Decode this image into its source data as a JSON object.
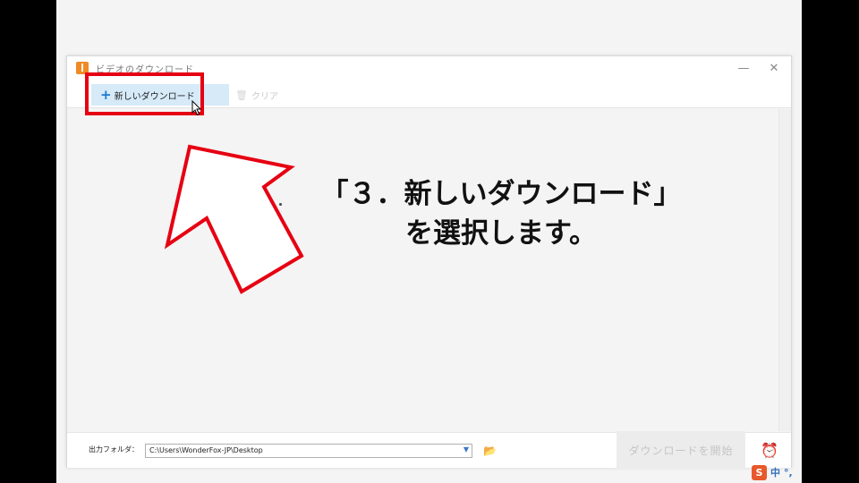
{
  "window": {
    "title": "ビデオのダウンロード",
    "minimize_glyph": "—",
    "close_glyph": "✕"
  },
  "toolbar": {
    "new_download_label": "新しいダウンロード",
    "clear_label": "クリア"
  },
  "bottom": {
    "output_folder_label": "出力フォルダ：",
    "output_folder_value": "C:\\Users\\WonderFox-JP\\Desktop",
    "start_label": "ダウンロードを開始"
  },
  "caption": {
    "line1": "「３．新しいダウンロード」",
    "line2": "を選択します。"
  },
  "ime": {
    "logo": "S",
    "mode": "中",
    "punct": "°,"
  },
  "colors": {
    "highlight": "#e60012",
    "accent": "#1e7ad1",
    "button_bg": "#d6eaf8"
  },
  "icons": [
    "app-logo-icon",
    "plus-icon",
    "trash-icon",
    "chevron-down-icon",
    "folder-open-icon",
    "alarm-clock-icon",
    "mouse-cursor-icon"
  ]
}
